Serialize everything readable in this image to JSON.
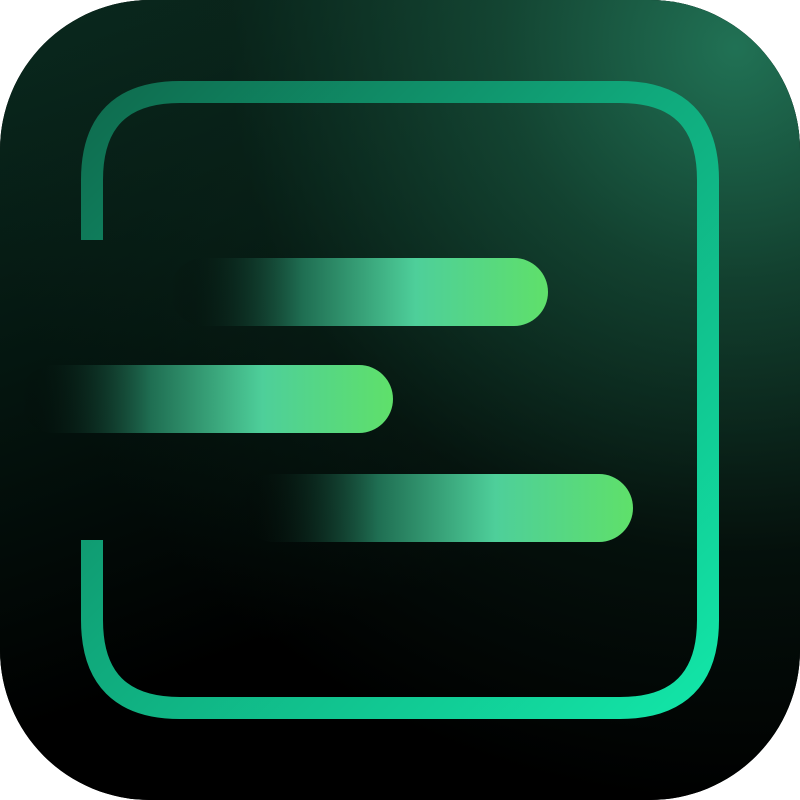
{
  "icon": {
    "name": "app-icon",
    "colors": {
      "background_dark": "#000000",
      "background_glow": "#227658",
      "frame_top_left": "#0f6b4e",
      "frame_bottom_right": "#12e6a8",
      "bar_fade_mid": "#4ecf9a",
      "bar_tip": "#5fe06a"
    },
    "bars": [
      {
        "name": "top-speed-bar"
      },
      {
        "name": "middle-speed-bar"
      },
      {
        "name": "bottom-speed-bar"
      }
    ]
  }
}
